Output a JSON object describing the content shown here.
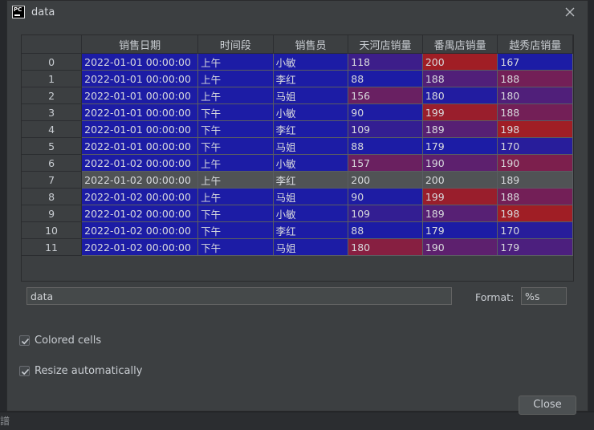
{
  "window": {
    "title": "data",
    "app_icon_text": "PC"
  },
  "table": {
    "columns": [
      "",
      "销售日期",
      "时间段",
      "销售员",
      "天河店销量",
      "番禺店销量",
      "越秀店销量"
    ],
    "rows": [
      {
        "index": "0",
        "date": "2022-01-01 00:00:00",
        "period": "上午",
        "seller": "小敏",
        "tianhe": "118",
        "panyu": "200",
        "yuexiu": "167"
      },
      {
        "index": "1",
        "date": "2022-01-01 00:00:00",
        "period": "上午",
        "seller": "李红",
        "tianhe": "88",
        "panyu": "188",
        "yuexiu": "188"
      },
      {
        "index": "2",
        "date": "2022-01-01 00:00:00",
        "period": "上午",
        "seller": "马姐",
        "tianhe": "156",
        "panyu": "180",
        "yuexiu": "180"
      },
      {
        "index": "3",
        "date": "2022-01-01 00:00:00",
        "period": "下午",
        "seller": "小敏",
        "tianhe": "90",
        "panyu": "199",
        "yuexiu": "188"
      },
      {
        "index": "4",
        "date": "2022-01-01 00:00:00",
        "period": "下午",
        "seller": "李红",
        "tianhe": "109",
        "panyu": "189",
        "yuexiu": "198"
      },
      {
        "index": "5",
        "date": "2022-01-01 00:00:00",
        "period": "下午",
        "seller": "马姐",
        "tianhe": "88",
        "panyu": "179",
        "yuexiu": "170"
      },
      {
        "index": "6",
        "date": "2022-01-02 00:00:00",
        "period": "上午",
        "seller": "小敏",
        "tianhe": "157",
        "panyu": "190",
        "yuexiu": "190"
      },
      {
        "index": "7",
        "date": "2022-01-02 00:00:00",
        "period": "上午",
        "seller": "李红",
        "tianhe": "200",
        "panyu": "200",
        "yuexiu": "189"
      },
      {
        "index": "8",
        "date": "2022-01-02 00:00:00",
        "period": "上午",
        "seller": "马姐",
        "tianhe": "90",
        "panyu": "199",
        "yuexiu": "188"
      },
      {
        "index": "9",
        "date": "2022-01-02 00:00:00",
        "period": "下午",
        "seller": "小敏",
        "tianhe": "109",
        "panyu": "189",
        "yuexiu": "198"
      },
      {
        "index": "10",
        "date": "2022-01-02 00:00:00",
        "period": "下午",
        "seller": "李红",
        "tianhe": "88",
        "panyu": "179",
        "yuexiu": "170"
      },
      {
        "index": "11",
        "date": "2022-01-02 00:00:00",
        "period": "下午",
        "seller": "马姐",
        "tianhe": "180",
        "panyu": "190",
        "yuexiu": "179"
      }
    ],
    "highlighted_row": 7,
    "colors": {
      "low": "#1c1ca5",
      "mid": "#5a2072",
      "high": "#a01e25",
      "highlight_row": "#505355"
    }
  },
  "name_field": {
    "value": "data"
  },
  "format": {
    "label": "Format:",
    "value": "%s"
  },
  "options": {
    "colored_cells": {
      "label": "Colored cells",
      "checked": true
    },
    "resize_auto": {
      "label": "Resize automatically",
      "checked": true
    }
  },
  "buttons": {
    "close_label": "Close"
  },
  "background_app": {
    "ghost_text": "譜"
  },
  "icons": {
    "close": "close-icon",
    "check": "check-icon",
    "app": "pycharm-icon"
  }
}
